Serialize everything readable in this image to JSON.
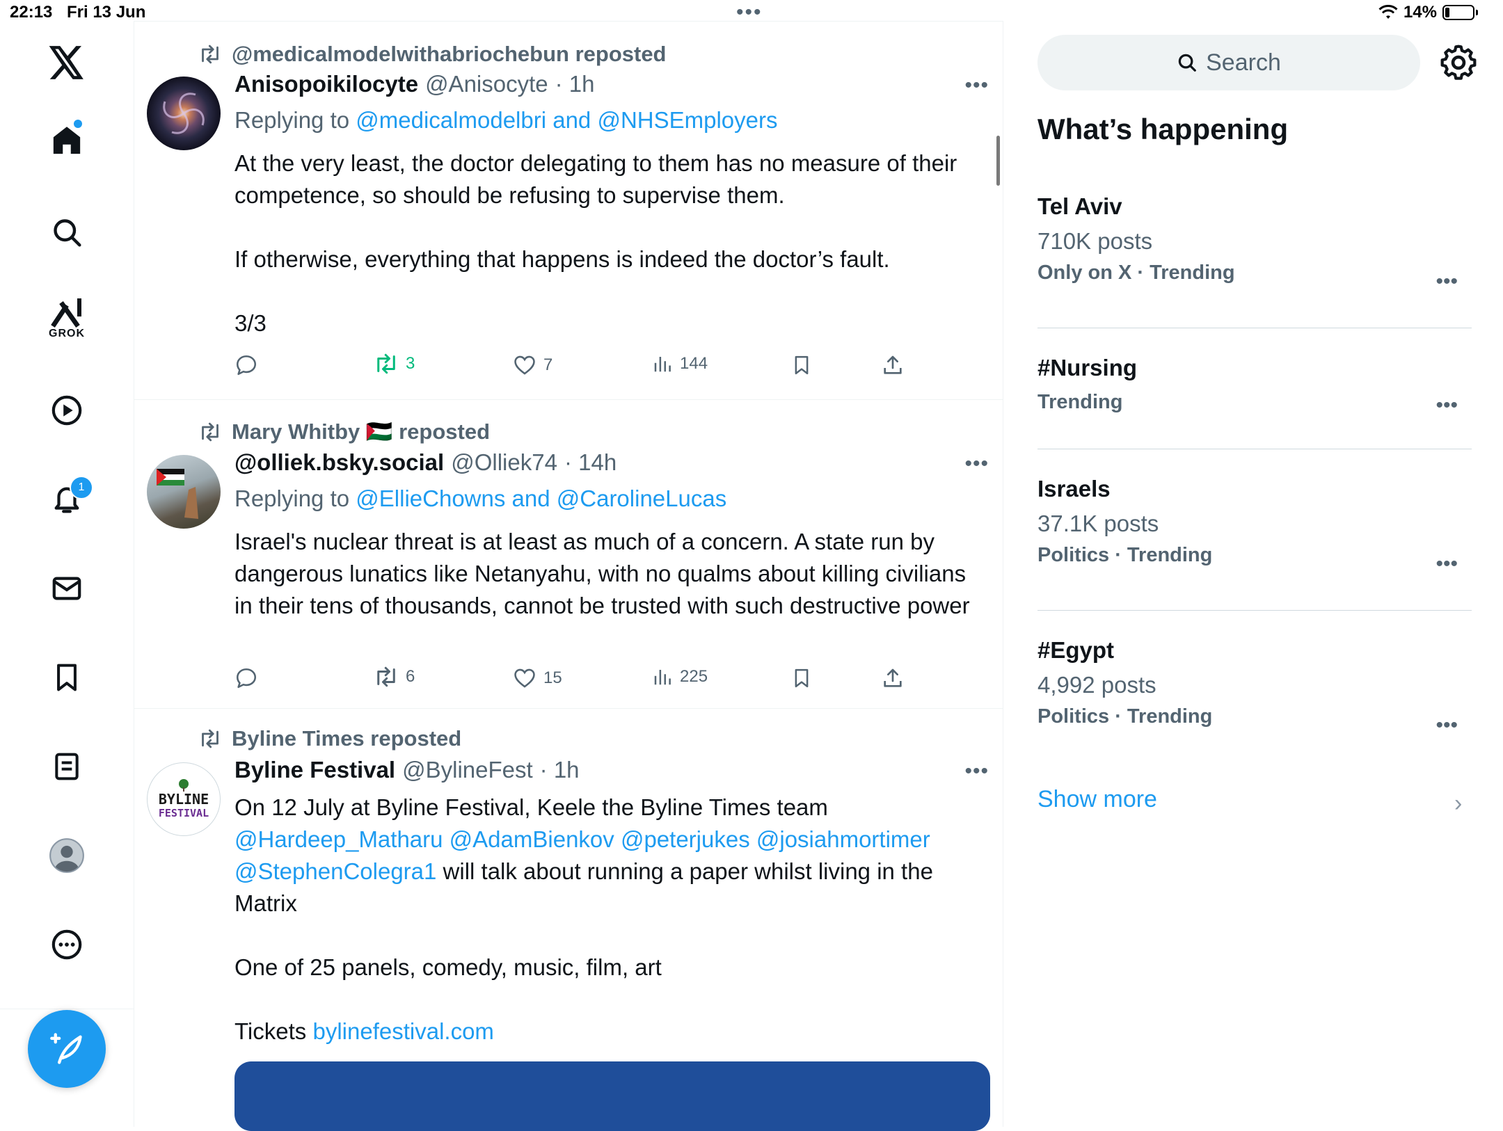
{
  "status_bar": {
    "time": "22:13",
    "date": "Fri 13 Jun",
    "battery": "14%"
  },
  "nav": {
    "grok_label": "GROK",
    "notifications_badge": "1"
  },
  "feed": {
    "posts": [
      {
        "reposted_by": "@medicalmodelwithabriochebun reposted",
        "name": "Anisopoikilocyte",
        "handle": "@Anisocyte",
        "time": "· 1h",
        "replying_prefix": "Replying to",
        "replying_to": "@medicalmodelbri and @NHSEmployers",
        "text": "At the very least, the doctor delegating to them has no measure of their competence, so should be refusing to supervise them.\n\nIf otherwise, everything that happens is indeed the doctor’s fault.\n\n3/3",
        "reposts": "3",
        "likes": "7",
        "views": "144"
      },
      {
        "reposted_by": "Mary Whitby 🇵🇸 reposted",
        "name": "@olliek.bsky.social",
        "handle": "@Olliek74",
        "time": "· 14h",
        "replying_prefix": "Replying to",
        "replying_to": "@EllieChowns and @CarolineLucas",
        "text": "Israel's nuclear threat is at least as much of a concern. A state run by dangerous lunatics like Netanyahu, with no qualms about killing civilians in their tens of thousands, cannot be trusted with such destructive power",
        "reposts": "6",
        "likes": "15",
        "views": "225"
      },
      {
        "reposted_by": "Byline Times reposted",
        "name": "Byline Festival",
        "handle": "@BylineFest",
        "time": "· 1h",
        "text_line1": "On 12 July at Byline Festival, Keele the Byline Times team",
        "mentions": "@Hardeep_Matharu @AdamBienkov @peterjukes @josiahmortimer",
        "mention_last": "@StephenColegra1",
        "text_after_mention": " will talk about  running a paper whilst living in the Matrix",
        "text_panels": "One of 25 panels, comedy, music, film, art",
        "tickets_label": "Tickets ",
        "tickets_link": "bylinefestival.com",
        "avatar_line1": "BYLINE",
        "avatar_line2": "FESTIVAL"
      }
    ]
  },
  "sidebar": {
    "search_placeholder": "Search",
    "whats_happening": "What’s happening",
    "trends": [
      {
        "title": "Tel Aviv",
        "count": "710K posts",
        "meta": "Only on X · Trending"
      },
      {
        "title": "#Nursing",
        "count": "",
        "meta": "Trending"
      },
      {
        "title": "Israels",
        "count": "37.1K posts",
        "meta": "Politics · Trending"
      },
      {
        "title": "#Egypt",
        "count": "4,992 posts",
        "meta": "Politics · Trending"
      }
    ],
    "show_more": "Show more"
  },
  "colors": {
    "accent": "#1d9bf0",
    "secondary_text": "#536471",
    "repost_green": "#00ba7c"
  },
  "icons": [
    "x-logo-icon",
    "home-icon",
    "search-icon",
    "grok-icon",
    "video-icon",
    "bell-icon",
    "mail-icon",
    "bookmark-icon",
    "lists-icon",
    "profile-icon",
    "more-icon",
    "compose-icon",
    "gear-icon"
  ]
}
